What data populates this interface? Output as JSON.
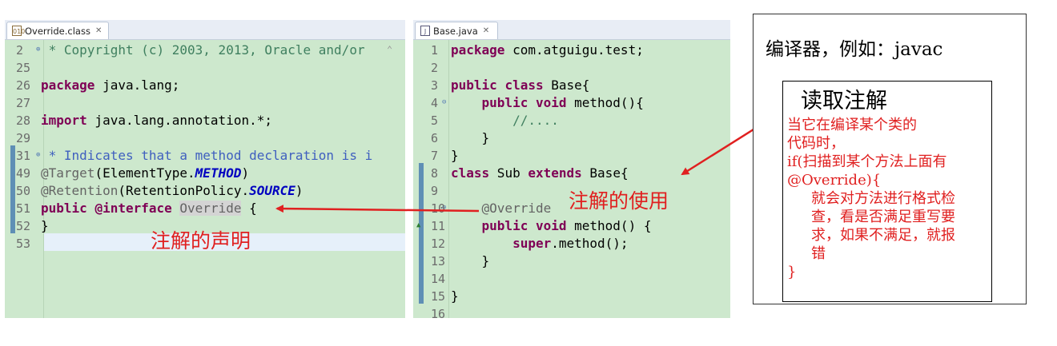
{
  "left_editor": {
    "tab_label": "Override.class",
    "tab_icon": "class-file-icon",
    "lines": [
      {
        "num": "2",
        "segments": [
          {
            "t": " * Copyright (c) 2003, 2013, Oracle and/or ",
            "c": "cm"
          }
        ]
      },
      {
        "num": "25",
        "segments": []
      },
      {
        "num": "26",
        "segments": [
          {
            "t": "package",
            "c": "kw"
          },
          {
            "t": " java.lang;",
            "c": ""
          }
        ]
      },
      {
        "num": "27",
        "segments": []
      },
      {
        "num": "28",
        "segments": [
          {
            "t": "import",
            "c": "kw"
          },
          {
            "t": " java.lang.annotation.*;",
            "c": ""
          }
        ]
      },
      {
        "num": "29",
        "segments": []
      },
      {
        "num": "31",
        "segments": [
          {
            "t": " * Indicates that a method declaration is i",
            "c": "dc"
          }
        ]
      },
      {
        "num": "49",
        "segments": [
          {
            "t": "@Target",
            "c": "an"
          },
          {
            "t": "(ElementType.",
            "c": ""
          },
          {
            "t": "METHOD",
            "c": "ce"
          },
          {
            "t": ")",
            "c": ""
          }
        ]
      },
      {
        "num": "50",
        "segments": [
          {
            "t": "@Retention",
            "c": "an"
          },
          {
            "t": "(RetentionPolicy.",
            "c": ""
          },
          {
            "t": "SOURCE",
            "c": "ce"
          },
          {
            "t": ")",
            "c": ""
          }
        ]
      },
      {
        "num": "51",
        "segments": [
          {
            "t": "public",
            "c": "kw"
          },
          {
            "t": " ",
            "c": ""
          },
          {
            "t": "@interface",
            "c": "kw"
          },
          {
            "t": " ",
            "c": ""
          },
          {
            "t": "Override",
            "c": "hl"
          },
          {
            "t": " {",
            "c": ""
          }
        ]
      },
      {
        "num": "52",
        "segments": [
          {
            "t": "}",
            "c": ""
          }
        ]
      },
      {
        "num": "53",
        "segments": []
      }
    ]
  },
  "right_editor": {
    "tab_label": "Base.java",
    "tab_icon": "java-file-icon",
    "lines": [
      {
        "num": "1",
        "segments": [
          {
            "t": "package",
            "c": "kw"
          },
          {
            "t": " com.atguigu.test;",
            "c": ""
          }
        ]
      },
      {
        "num": "2",
        "segments": []
      },
      {
        "num": "3",
        "segments": [
          {
            "t": "public",
            "c": "kw"
          },
          {
            "t": " ",
            "c": ""
          },
          {
            "t": "class",
            "c": "kw"
          },
          {
            "t": " Base{",
            "c": ""
          }
        ]
      },
      {
        "num": "4",
        "segments": [
          {
            "t": "    ",
            "c": ""
          },
          {
            "t": "public",
            "c": "kw"
          },
          {
            "t": " ",
            "c": ""
          },
          {
            "t": "void",
            "c": "kw"
          },
          {
            "t": " method(){",
            "c": ""
          }
        ]
      },
      {
        "num": "5",
        "segments": [
          {
            "t": "        //....",
            "c": "cm"
          }
        ]
      },
      {
        "num": "6",
        "segments": [
          {
            "t": "    }",
            "c": ""
          }
        ]
      },
      {
        "num": "7",
        "segments": [
          {
            "t": "}",
            "c": ""
          }
        ]
      },
      {
        "num": "8",
        "segments": [
          {
            "t": "class",
            "c": "kw"
          },
          {
            "t": " Sub ",
            "c": ""
          },
          {
            "t": "extends",
            "c": "kw"
          },
          {
            "t": " Base{",
            "c": ""
          }
        ]
      },
      {
        "num": "9",
        "segments": []
      },
      {
        "num": "10",
        "segments": [
          {
            "t": "    ",
            "c": ""
          },
          {
            "t": "@Override",
            "c": "an"
          }
        ]
      },
      {
        "num": "11",
        "segments": [
          {
            "t": "    ",
            "c": ""
          },
          {
            "t": "public",
            "c": "kw"
          },
          {
            "t": " ",
            "c": ""
          },
          {
            "t": "void",
            "c": "kw"
          },
          {
            "t": " method() {",
            "c": ""
          }
        ]
      },
      {
        "num": "12",
        "segments": [
          {
            "t": "        ",
            "c": ""
          },
          {
            "t": "super",
            "c": "kw"
          },
          {
            "t": ".method();",
            "c": ""
          }
        ]
      },
      {
        "num": "13",
        "segments": [
          {
            "t": "    }",
            "c": ""
          }
        ]
      },
      {
        "num": "14",
        "segments": []
      },
      {
        "num": "15",
        "segments": [
          {
            "t": "}",
            "c": ""
          }
        ]
      },
      {
        "num": "16",
        "segments": []
      }
    ]
  },
  "annotations": {
    "declaration_label": "注解的声明",
    "usage_label": "注解的使用",
    "compiler_title": "编译器，例如：javac",
    "read_title": "读取注解",
    "read_body": [
      "当它在编译某个类的",
      "代码时，",
      "if(扫描到某个方法上面有",
      "@Override){",
      "就会对方法进行格式检",
      "查，看是否满足重写要",
      "求，如果不满足，就报",
      "错",
      "}"
    ]
  },
  "colors": {
    "editor_bg": "#cde8cd",
    "keyword": "#7f0055",
    "annotation_text": "#e02020",
    "arrow": "#e02020"
  }
}
